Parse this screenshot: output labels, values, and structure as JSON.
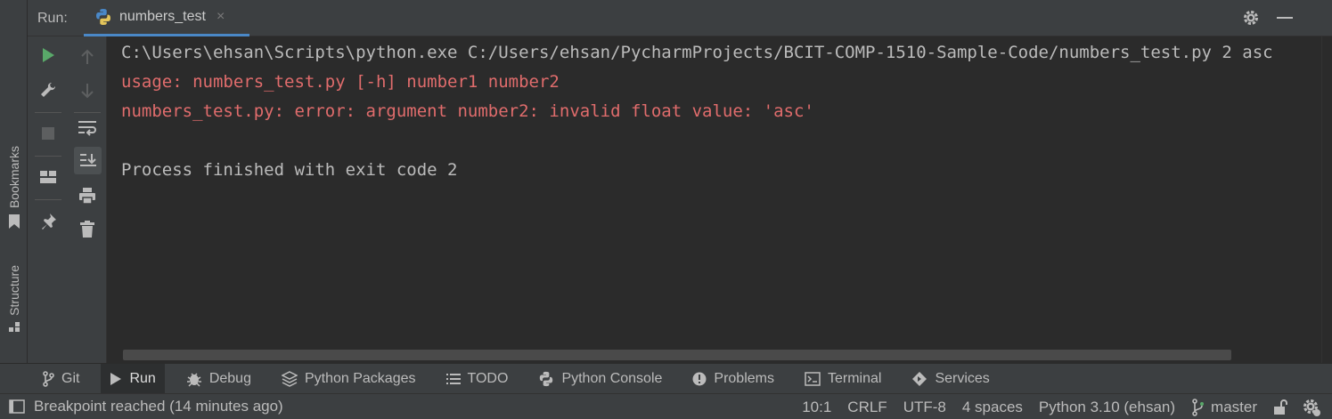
{
  "header": {
    "run_label": "Run:",
    "tab_label": "numbers_test",
    "tab_close": "×"
  },
  "left_stripe": {
    "bookmarks_label": "Bookmarks",
    "structure_label": "Structure"
  },
  "console": {
    "lines": [
      {
        "text": "C:\\Users\\ehsan\\Scripts\\python.exe C:/Users/ehsan/PycharmProjects/BCIT-COMP-1510-Sample-Code/numbers_test.py 2 asc",
        "type": "command"
      },
      {
        "text": "usage: numbers_test.py [-h] number1 number2",
        "type": "error"
      },
      {
        "text": "numbers_test.py: error: argument number2: invalid float value: 'asc'",
        "type": "error"
      },
      {
        "text": "Process finished with exit code 2",
        "type": "normal"
      }
    ]
  },
  "bottom_tools": [
    {
      "label": "Git",
      "icon": "git-branch-icon"
    },
    {
      "label": "Run",
      "icon": "run-play-icon",
      "active": true
    },
    {
      "label": "Debug",
      "icon": "bug-icon"
    },
    {
      "label": "Python Packages",
      "icon": "layers-icon"
    },
    {
      "label": "TODO",
      "icon": "list-icon"
    },
    {
      "label": "Python Console",
      "icon": "python-icon"
    },
    {
      "label": "Problems",
      "icon": "alert-icon"
    },
    {
      "label": "Terminal",
      "icon": "terminal-icon"
    },
    {
      "label": "Services",
      "icon": "services-icon"
    }
  ],
  "status_bar": {
    "message": "Breakpoint reached (14 minutes ago)",
    "position": "10:1",
    "line_separator": "CRLF",
    "encoding": "UTF-8",
    "indent": "4 spaces",
    "interpreter": "Python 3.10 (ehsan)",
    "branch": "master"
  },
  "colors": {
    "console_bg": "#2b2b2b",
    "error_text": "#e06c6c",
    "normal_text": "#bbbbbb",
    "run_green": "#59a869",
    "accent_blue": "#4a88c7"
  }
}
